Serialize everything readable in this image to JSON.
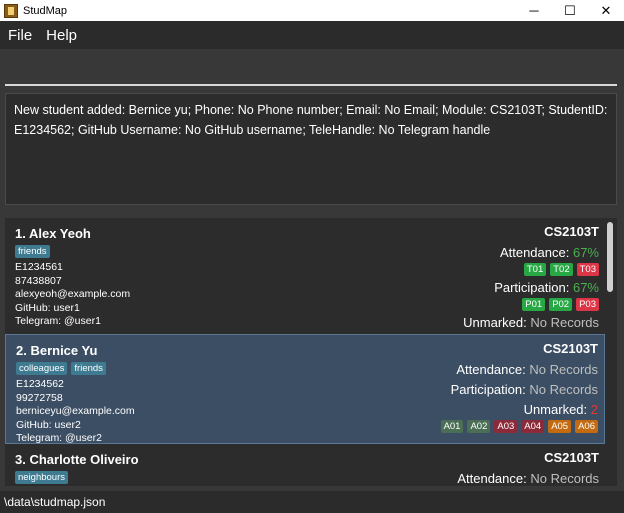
{
  "window": {
    "title": "StudMap",
    "min_label": "─",
    "max_label": "☐",
    "close_label": "✕"
  },
  "menu": {
    "items": [
      {
        "label": "File"
      },
      {
        "label": "Help"
      }
    ]
  },
  "command": {
    "value": "",
    "placeholder": ""
  },
  "result": {
    "text": "New student added: Bernice yu; Phone: No Phone number; Email: No Email; Module: CS2103T; StudentID: E1234562; GitHub Username: No GitHub username; TeleHandle: No Telegram handle"
  },
  "students": [
    {
      "name": "1.  Alex Yeoh",
      "tags": [
        "friends"
      ],
      "lines": [
        "E1234561",
        "87438807",
        "alexyeoh@example.com",
        "GitHub: user1",
        "Telegram: @user1"
      ],
      "module": "CS2103T",
      "attendance_label": "Attendance:",
      "attendance_value": "67%",
      "attendance_badges": [
        {
          "label": "T01",
          "status": "present"
        },
        {
          "label": "T02",
          "status": "present"
        },
        {
          "label": "T03",
          "status": "absent"
        }
      ],
      "participation_label": "Participation:",
      "participation_value": "67%",
      "participation_badges": [
        {
          "label": "P01",
          "status": "present"
        },
        {
          "label": "P02",
          "status": "present"
        },
        {
          "label": "P03",
          "status": "absent"
        }
      ],
      "unmarked_label": "Unmarked:",
      "unmarked_value": "No Records"
    },
    {
      "name": "2.  Bernice Yu",
      "tags": [
        "colleagues",
        "friends"
      ],
      "lines": [
        "E1234562",
        "99272758",
        "berniceyu@example.com",
        "GitHub: user2",
        "Telegram: @user2"
      ],
      "module": "CS2103T",
      "attendance_label": "Attendance:",
      "attendance_value": "No Records",
      "participation_label": "Participation:",
      "participation_value": "No Records",
      "unmarked_label": "Unmarked:",
      "unmarked_value": "2",
      "unmarked_badges": [
        {
          "label": "A01",
          "kind": "dgreen"
        },
        {
          "label": "A02",
          "kind": "dgreen"
        },
        {
          "label": "A03",
          "kind": "dred"
        },
        {
          "label": "A04",
          "kind": "dred"
        },
        {
          "label": "A05",
          "kind": "orange"
        },
        {
          "label": "A06",
          "kind": "orange"
        }
      ]
    },
    {
      "name": "3.  Charlotte Oliveiro",
      "tags": [
        "neighbours"
      ],
      "module": "CS2103T",
      "attendance_label": "Attendance:",
      "attendance_value": "No Records"
    }
  ],
  "status": {
    "path": "\\data\\studmap.json"
  },
  "colors": {
    "background": "#383838",
    "selected_card": "#3c4e64",
    "tag": "#3e7b91",
    "present": "#28a745",
    "absent": "#dc3545"
  }
}
